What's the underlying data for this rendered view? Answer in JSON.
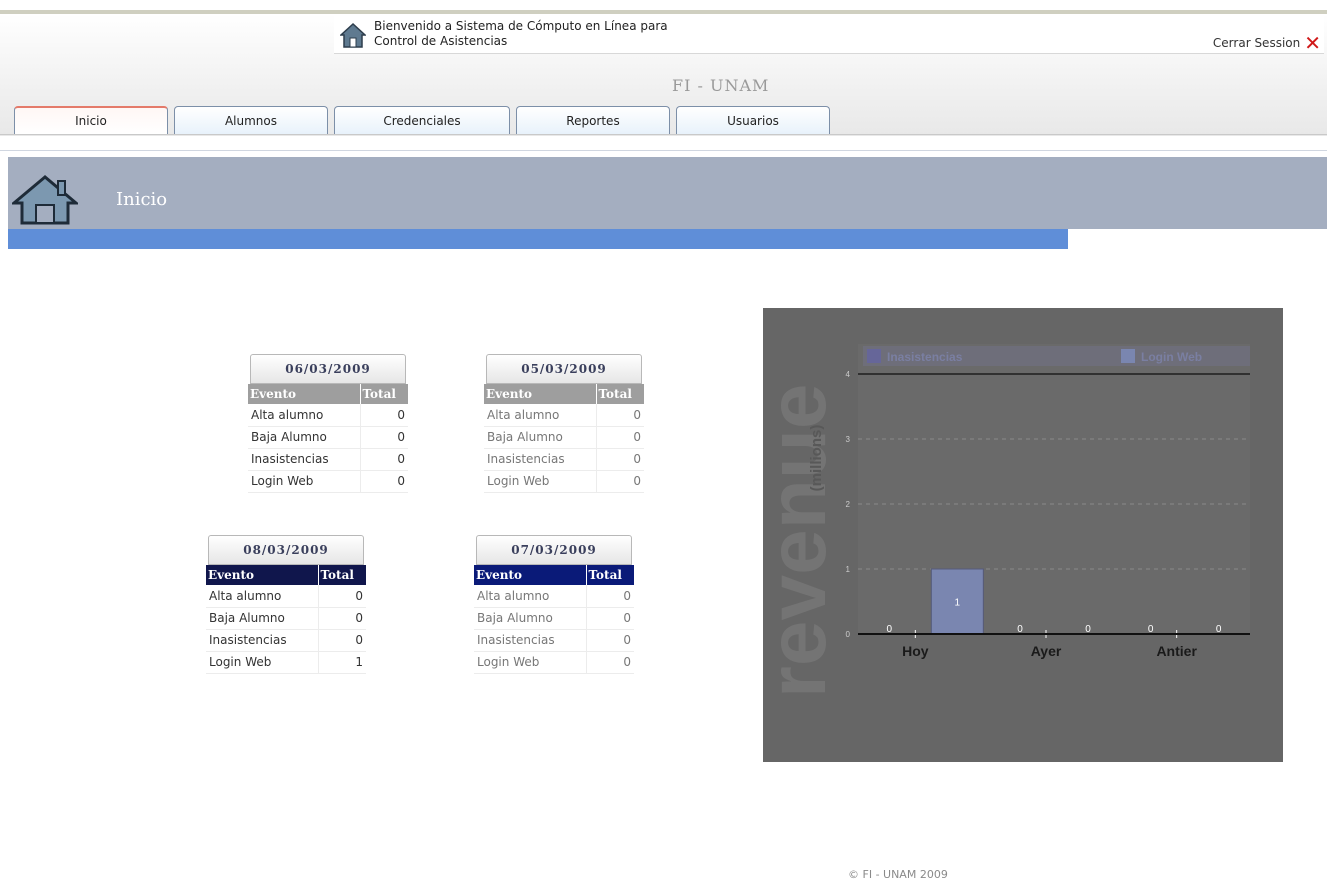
{
  "header": {
    "welcome_line1": "Bienvenido a Sistema de Cómputo en Línea para",
    "welcome_line2": "Control de Asistencias",
    "logout_label": "Cerrar Session",
    "organization": "FI - UNAM"
  },
  "tabs": [
    {
      "label": "Inicio",
      "active": true
    },
    {
      "label": "Alumnos",
      "active": false
    },
    {
      "label": "Credenciales",
      "active": false
    },
    {
      "label": "Reportes",
      "active": false
    },
    {
      "label": "Usuarios",
      "active": false
    }
  ],
  "section": {
    "title": "Inicio"
  },
  "stats_tables": [
    {
      "date": "06/03/2009",
      "headers": [
        "Evento",
        "Total"
      ],
      "rows": [
        [
          "Alta alumno",
          "0"
        ],
        [
          "Baja Alumno",
          "0"
        ],
        [
          "Inasistencias",
          "0"
        ],
        [
          "Login Web",
          "0"
        ]
      ]
    },
    {
      "date": "05/03/2009",
      "headers": [
        "Evento",
        "Total"
      ],
      "rows": [
        [
          "Alta alumno",
          "0"
        ],
        [
          "Baja Alumno",
          "0"
        ],
        [
          "Inasistencias",
          "0"
        ],
        [
          "Login Web",
          "0"
        ]
      ]
    },
    {
      "date": "08/03/2009",
      "headers": [
        "Evento",
        "Total"
      ],
      "rows": [
        [
          "Alta alumno",
          "0"
        ],
        [
          "Baja Alumno",
          "0"
        ],
        [
          "Inasistencias",
          "0"
        ],
        [
          "Login Web",
          "1"
        ]
      ]
    },
    {
      "date": "07/03/2009",
      "headers": [
        "Evento",
        "Total"
      ],
      "rows": [
        [
          "Alta alumno",
          "0"
        ],
        [
          "Baja Alumno",
          "0"
        ],
        [
          "Inasistencias",
          "0"
        ],
        [
          "Login Web",
          "0"
        ]
      ]
    }
  ],
  "chart_data": {
    "type": "bar",
    "categories": [
      "Hoy",
      "Ayer",
      "Antier"
    ],
    "series": [
      {
        "name": "Inasistencias",
        "values": [
          0,
          0,
          0
        ],
        "color": "#666699"
      },
      {
        "name": "Login Web",
        "values": [
          1,
          0,
          0
        ],
        "color": "#7a86b0"
      }
    ],
    "value_labels": [
      [
        "0",
        "0",
        "0"
      ],
      [
        "1",
        "0",
        "0"
      ]
    ],
    "watermark": "revenue",
    "ylabel": "(millions)",
    "ylim": [
      0,
      4
    ],
    "yticks": [
      "0",
      "1",
      "2",
      "3",
      "4"
    ],
    "grid": true,
    "legend": "top",
    "background": "#666666"
  },
  "footer": {
    "text": "© FI - UNAM 2009"
  }
}
